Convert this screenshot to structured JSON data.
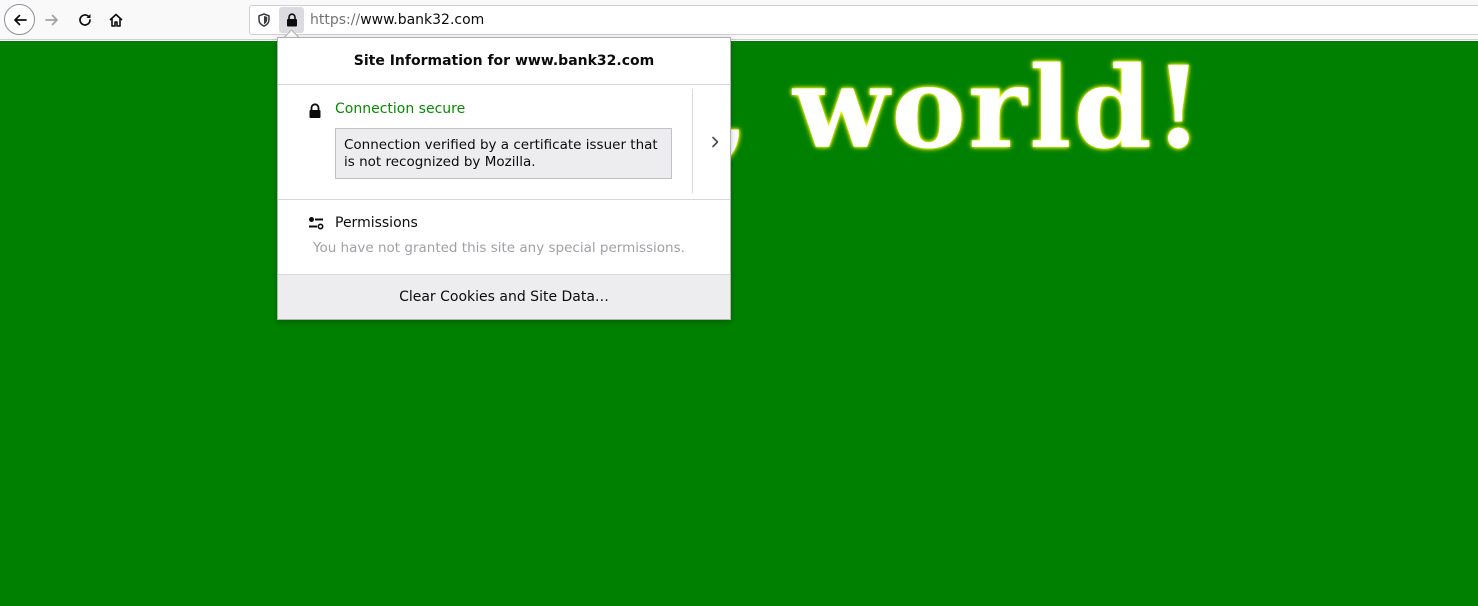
{
  "toolbar": {
    "back_icon": "arrow-left-icon",
    "forward_icon": "arrow-right-icon",
    "reload_icon": "reload-icon",
    "home_icon": "home-icon"
  },
  "urlbar": {
    "scheme": "https://",
    "host": "www.bank32.com",
    "shield_icon": "tracking-protection-shield-icon",
    "lock_icon": "lock-icon"
  },
  "page": {
    "headline": "Hello, world!",
    "background_color": "#008000"
  },
  "panel": {
    "title": "Site Information for www.bank32.com",
    "security": {
      "title": "Connection secure",
      "detail": "Connection verified by a certificate issuer that is not recognized by Mozilla.",
      "title_color": "#058b00"
    },
    "permissions": {
      "title": "Permissions",
      "description": "You have not granted this site any special permissions."
    },
    "clear_button_label": "Clear Cookies and Site Data…"
  }
}
